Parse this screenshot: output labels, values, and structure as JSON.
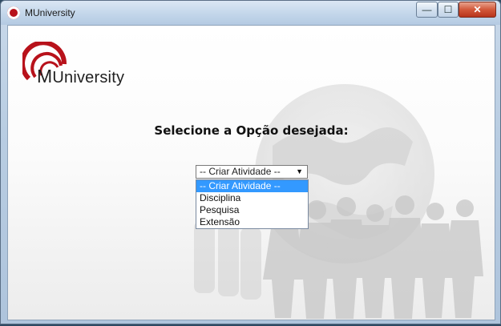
{
  "window": {
    "title": "MUniversity",
    "minimize_label": "—",
    "maximize_label": "☐",
    "close_label": "✕"
  },
  "logo": {
    "first_letter": "M",
    "rest": "University"
  },
  "main": {
    "heading": "Selecione a Opção desejada:",
    "select": {
      "current_value": "-- Criar Atividade --",
      "arrow": "▼",
      "options": [
        "-- Criar Atividade --",
        "Disciplina",
        "Pesquisa",
        "Extensão"
      ],
      "highlighted_index": 0
    }
  },
  "colors": {
    "highlight": "#3399ff",
    "brand_red": "#b8121b"
  }
}
